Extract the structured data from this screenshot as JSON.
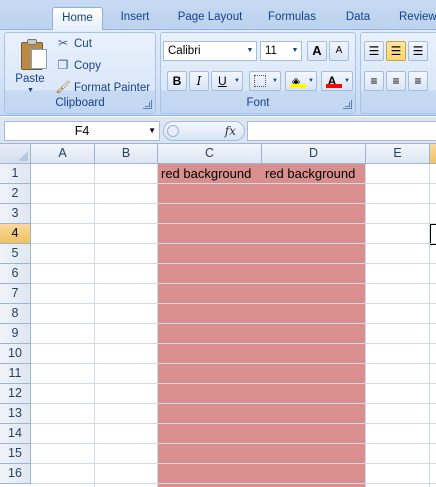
{
  "tabs": [
    {
      "label": "Home",
      "active": true
    },
    {
      "label": "Insert",
      "active": false
    },
    {
      "label": "Page Layout",
      "active": false
    },
    {
      "label": "Formulas",
      "active": false
    },
    {
      "label": "Data",
      "active": false
    },
    {
      "label": "Review",
      "active": false
    }
  ],
  "clipboard": {
    "group_label": "Clipboard",
    "paste_label": "Paste",
    "cut_label": "Cut",
    "copy_label": "Copy",
    "format_painter_label": "Format Painter"
  },
  "font": {
    "group_label": "Font",
    "font_name": "Calibri",
    "font_size": "11",
    "bold": "B",
    "italic": "I",
    "underline": "U",
    "grow": "A",
    "shrink": "A",
    "font_color_letter": "A",
    "font_color": "#ff0000",
    "fill_color": "#ffff00"
  },
  "formula_bar": {
    "name_box": "F4",
    "fx_label": "fx",
    "formula_value": ""
  },
  "grid": {
    "columns": [
      "A",
      "B",
      "C",
      "D",
      "E"
    ],
    "rows": [
      "1",
      "2",
      "3",
      "4",
      "5",
      "6",
      "7",
      "8",
      "9",
      "10",
      "11",
      "12",
      "13",
      "14",
      "15",
      "16"
    ],
    "active_row": "4",
    "active_column": "F",
    "fill_color": "#da8f8f",
    "cells": {
      "C1": "red background",
      "D1": "red background"
    }
  }
}
